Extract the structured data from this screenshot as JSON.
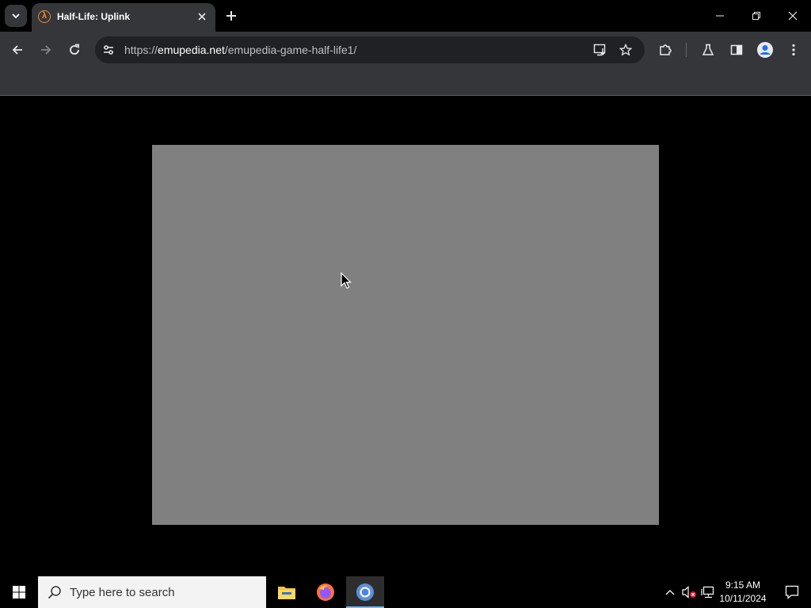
{
  "browser": {
    "tab": {
      "title": "Half-Life: Uplink",
      "favicon": "lambda-icon",
      "favicon_char": "λ"
    },
    "address_bar": {
      "url_scheme": "https://",
      "url_host": "emupedia.net",
      "url_path": "/emupedia-game-half-life1/"
    },
    "icons": {
      "tab_search": "chevron-down-icon",
      "new_tab": "plus-icon",
      "back": "arrow-left-icon",
      "forward": "arrow-right-icon",
      "reload": "reload-icon",
      "site_info": "tune-icon",
      "install_app": "install-icon",
      "bookmark": "star-icon",
      "extensions": "puzzle-icon",
      "labs": "flask-icon",
      "side_panel": "side-panel-icon",
      "profile": "profile-icon",
      "menu": "kebab-menu-icon"
    },
    "colors": {
      "chrome_bg": "#35363a",
      "omnibox_bg": "#202124",
      "favicon": "#f28b2b"
    }
  },
  "page": {
    "game_canvas": {
      "background": "#808080"
    }
  },
  "taskbar": {
    "search_placeholder": "Type here to search",
    "apps": [
      "file-explorer-icon",
      "firefox-icon",
      "chrome-icon"
    ],
    "active_app": "chrome-icon",
    "clock": {
      "time": "9:15 AM",
      "date": "10/11/2024"
    }
  }
}
